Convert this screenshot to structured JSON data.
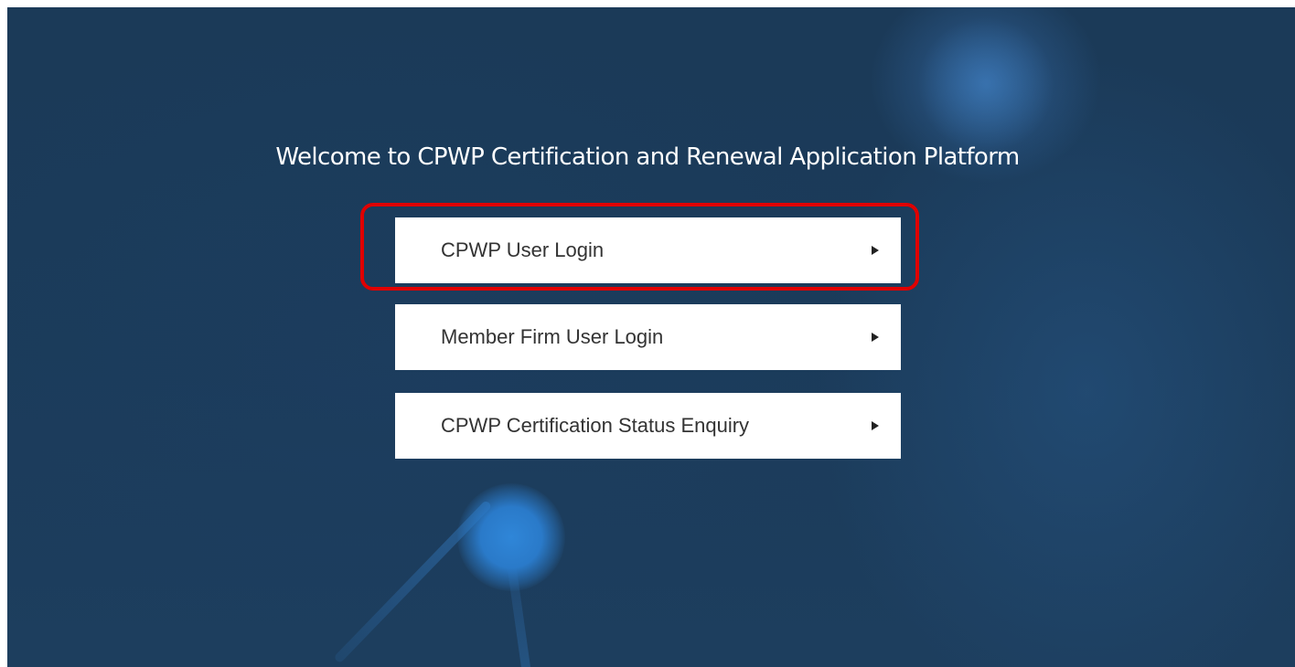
{
  "page": {
    "title": "Welcome to CPWP Certification and Renewal Application Platform"
  },
  "buttons": [
    {
      "label": "CPWP User Login",
      "icon": "triangle-right-icon"
    },
    {
      "label": "Member Firm User Login",
      "icon": "triangle-right-icon"
    },
    {
      "label": "CPWP Certification Status Enquiry",
      "icon": "triangle-right-icon"
    }
  ],
  "highlight": {
    "target": "CPWP User Login",
    "color": "#e00000"
  },
  "colors": {
    "background": "#1b3a58",
    "button_bg": "#ffffff",
    "button_text": "#333333",
    "title_text": "#ffffff",
    "accent_node": "#2f86d8"
  }
}
